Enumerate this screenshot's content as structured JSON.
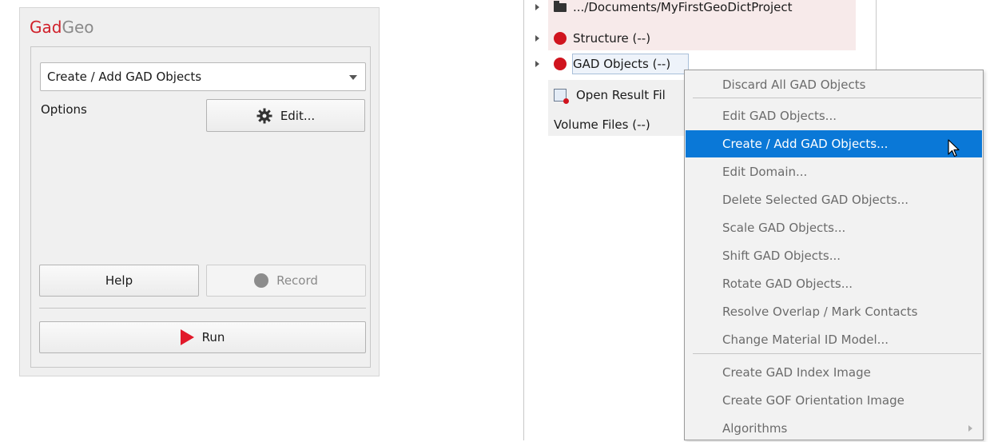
{
  "panel": {
    "title_part1": "Gad",
    "title_part2": "Geo",
    "command_combo": "Create / Add GAD Objects",
    "options_label": "Options",
    "edit_button": "Edit...",
    "help_button": "Help",
    "record_button": "Record",
    "run_button": "Run"
  },
  "tree": {
    "project_path": ".../Documents/MyFirstGeoDictProject",
    "structure": "Structure (--)",
    "gad_objects": "GAD Objects (--)",
    "open_result": "Open Result Fil",
    "volume_files": "Volume Files (--)"
  },
  "context_menu": {
    "items": [
      "Discard All GAD Objects",
      "Edit GAD Objects...",
      "Create / Add GAD Objects...",
      "Edit Domain...",
      "Delete Selected GAD Objects...",
      "Scale GAD Objects...",
      "Shift GAD Objects...",
      "Rotate GAD Objects...",
      "Resolve Overlap / Mark Contacts",
      "Change Material ID Model...",
      "Create GAD Index Image",
      "Create GOF Orientation Image",
      "Algorithms"
    ]
  },
  "colors": {
    "accent_red": "#d0202a",
    "highlight_blue": "#0a78d7"
  }
}
